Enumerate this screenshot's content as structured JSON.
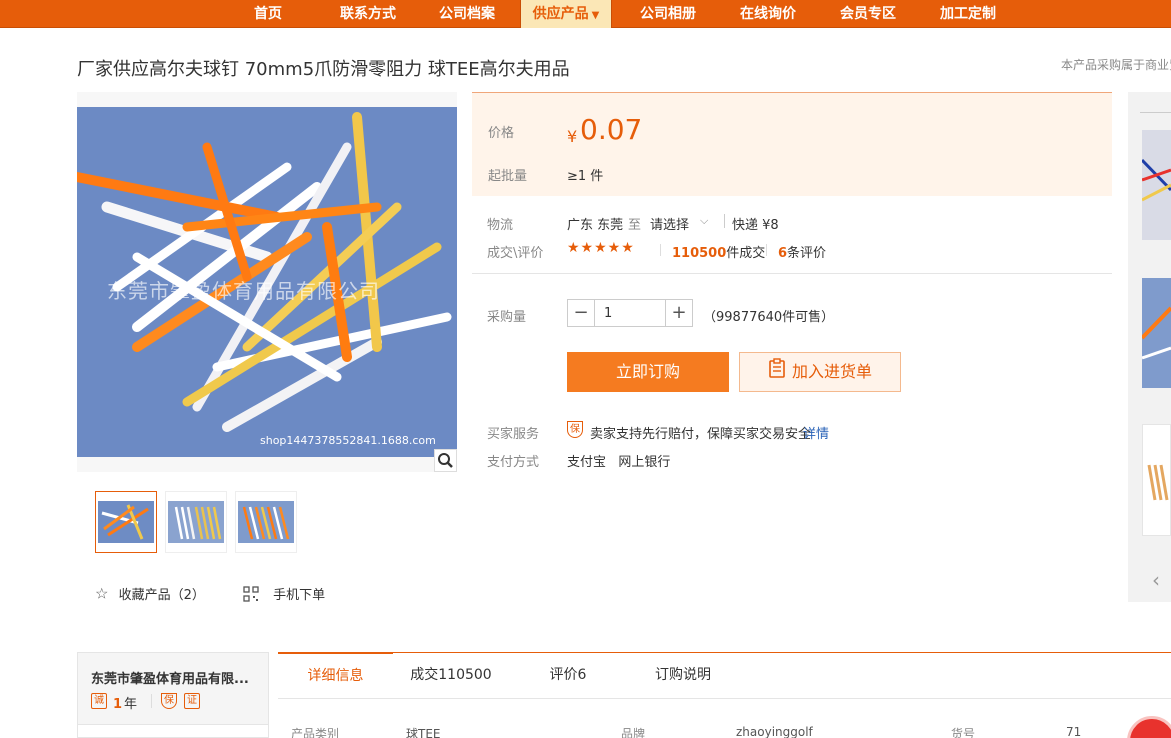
{
  "nav": {
    "items": [
      "首页",
      "联系方式",
      "公司档案",
      "供应产品",
      "公司相册",
      "在线询价",
      "会员专区",
      "加工定制"
    ],
    "active_caret": "▼"
  },
  "product": {
    "title": "厂家供应高尔夫球钉 70mm5爪防滑零阻力 球TEE高尔夫用品",
    "top_note": "本产品采购属于商业贸"
  },
  "gallery": {
    "watermark": "东莞市肇盈体育用品有限公司",
    "shop_url": "shop1447378552841.1688.com",
    "thumb_count": 3
  },
  "actions": {
    "favorite_label": "收藏产品（2）",
    "mobile_label": "手机下单"
  },
  "price": {
    "label": "价格",
    "currency": "¥",
    "value": "0.07",
    "moq_label": "起批量",
    "moq_value": "≥1 件"
  },
  "logistics": {
    "label": "物流",
    "from": "广东 东莞",
    "to_word": "至",
    "select": "请选择",
    "shipping": "快递 ¥8"
  },
  "deals": {
    "label": "成交\\评价",
    "stars": "★★★★★",
    "count": "110500",
    "count_suffix": "件成交",
    "reviews": "6",
    "reviews_suffix": "条评价"
  },
  "purchase": {
    "label": "采购量",
    "quantity": "1",
    "available": "（99877640件可售）",
    "buy_label": "立即订购",
    "cart_label": "加入进货单"
  },
  "service": {
    "label": "买家服务",
    "text": "卖家支持先行赔付，保障买家交易安全",
    "link": "详情",
    "payment_label": "支付方式",
    "payment_methods": "支付宝   网上银行"
  },
  "company": {
    "name": "东莞市肇盈体育用品有限...",
    "years_num": "1",
    "years_unit": "年",
    "badge_cheng": "诚",
    "badge_bao": "保",
    "badge_doc": "证"
  },
  "tabs": [
    "详细信息",
    "成交110500",
    "评价6",
    "订购说明"
  ],
  "details": {
    "category_key": "产品类别",
    "category_val": "球TEE",
    "brand_key": "品牌",
    "brand_val": "zhaoyinggolf",
    "sku_key": "货号",
    "sku_val": "71"
  },
  "colors": {
    "brand": "#e65d0a",
    "buy_button": "#f57b20",
    "price_bg": "#fff4ea",
    "link": "#2a63b8"
  }
}
